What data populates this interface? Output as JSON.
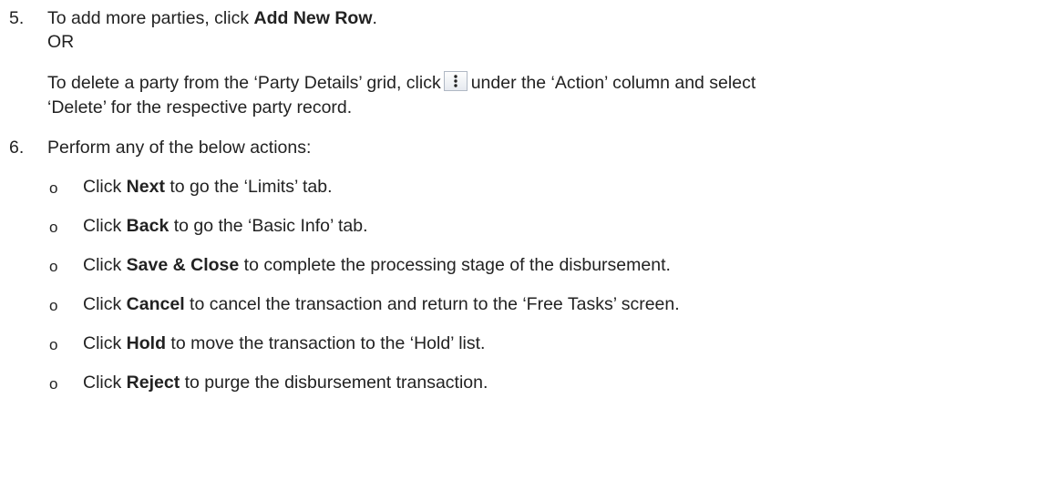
{
  "step5": {
    "number": "5.",
    "line1_pre": "To add more parties, click ",
    "line1_bold": "Add New Row",
    "line1_post": ".",
    "or": "OR",
    "line3_pre": "To delete a party from the ‘Party Details’ grid, click",
    "line3_post": "under the ‘Action’ column and select",
    "line4": "‘Delete’ for the respective party record.",
    "icon": "more-vertical-icon"
  },
  "step6": {
    "number": "6.",
    "intro": "Perform any of the below actions:",
    "bullet_char": "o",
    "items": [
      {
        "pre": "Click ",
        "bold": "Next",
        "post": " to go the ‘Limits’ tab."
      },
      {
        "pre": "Click ",
        "bold": "Back",
        "post": " to go the ‘Basic Info’ tab."
      },
      {
        "pre": "Click ",
        "bold": "Save & Close",
        "post": " to complete the processing stage of the disbursement."
      },
      {
        "pre": "Click ",
        "bold": "Cancel",
        "post": " to cancel the transaction and return to the ‘Free Tasks’ screen."
      },
      {
        "pre": "Click ",
        "bold": "Hold",
        "post": " to move the transaction to the ‘Hold’ list."
      },
      {
        "pre": "Click ",
        "bold": "Reject",
        "post": " to purge the disbursement transaction."
      }
    ]
  }
}
